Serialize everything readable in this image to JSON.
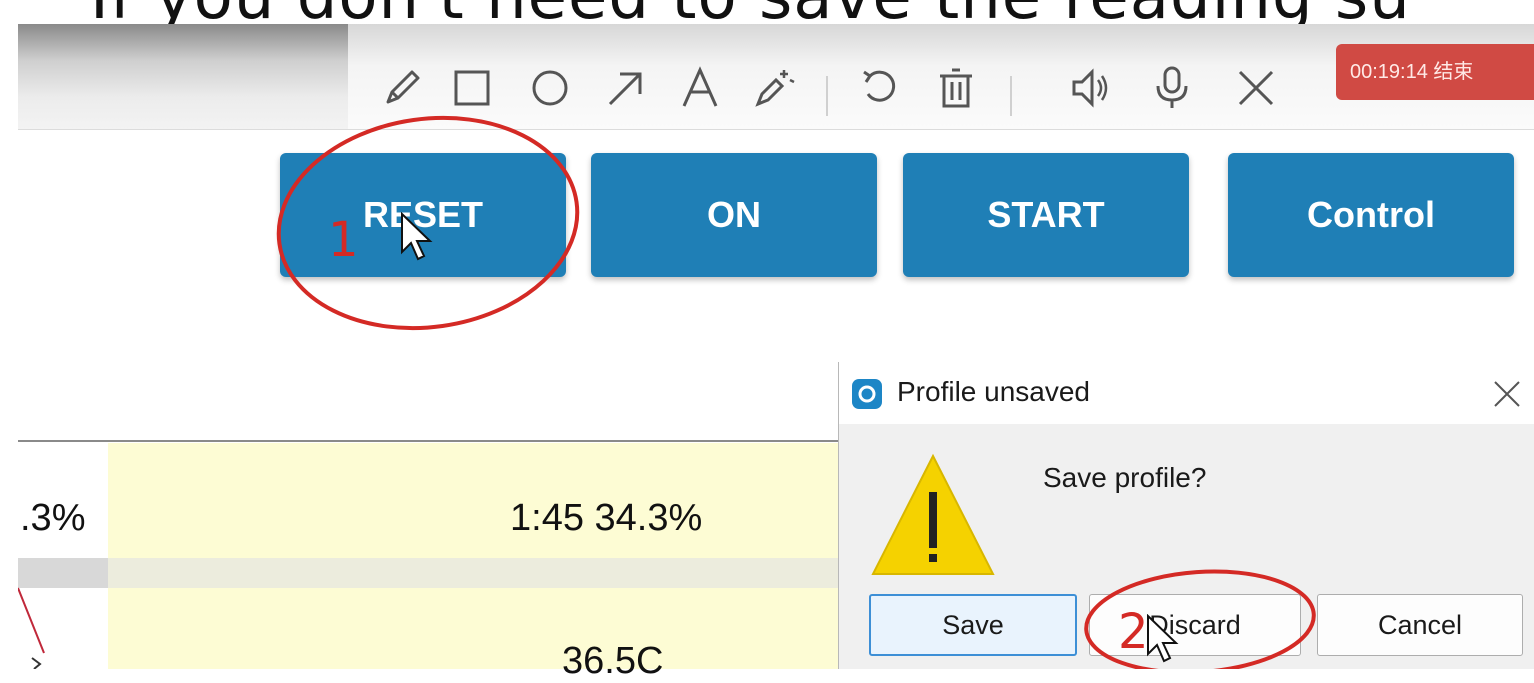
{
  "caption": {
    "text": "If you don't need to save the reading su"
  },
  "toolbar": {
    "icons": [
      "pencil-icon",
      "rectangle-icon",
      "circle-icon",
      "arrow-icon",
      "text-icon",
      "magic-wand-icon",
      "undo-icon",
      "trash-icon",
      "speaker-icon",
      "microphone-icon",
      "close-icon"
    ],
    "timer": "00:19:14 结束"
  },
  "buttons": {
    "reset": "RESET",
    "on": "ON",
    "start": "START",
    "control": "Control"
  },
  "annotations": {
    "step1": "1",
    "step2": "2"
  },
  "table": {
    "row1_left": ".3%",
    "row1_value": "1:45  34.3%",
    "row2_value": "36.5C"
  },
  "dialog": {
    "title": "Profile unsaved",
    "message": "Save profile?",
    "save": "Save",
    "discard": "Discard",
    "cancel": "Cancel"
  },
  "colors": {
    "accent_button": "#1f7fb6",
    "timer_bg": "#d04a44",
    "annotation_red": "#d42a25",
    "cell_yellow": "#fdfcd4",
    "warning_yellow": "#f5d200"
  }
}
